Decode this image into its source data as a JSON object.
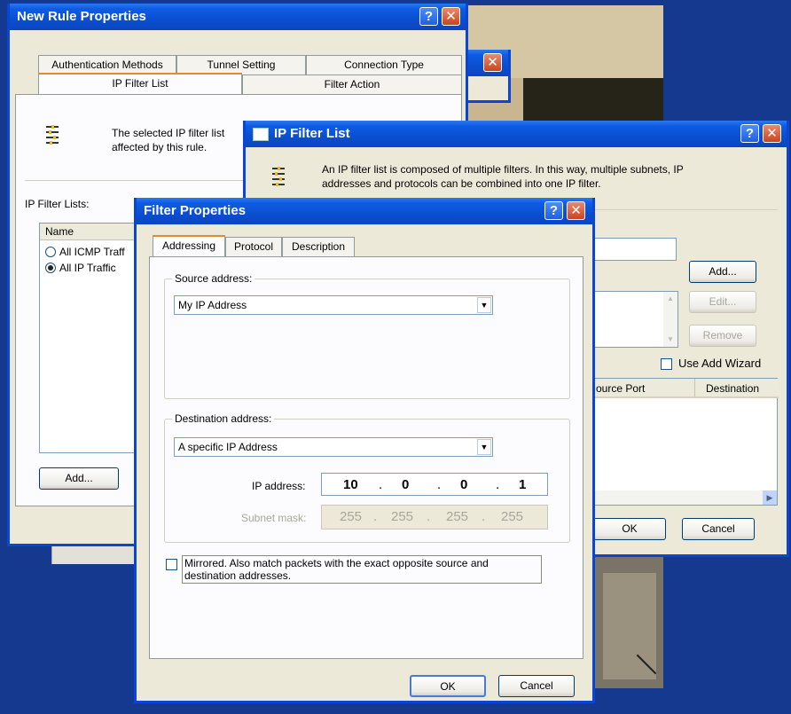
{
  "rule": {
    "title": "New Rule Properties",
    "tabs": [
      "Authentication Methods",
      "Tunnel Setting",
      "Connection Type",
      "IP Filter List",
      "Filter Action"
    ],
    "description": "The selected IP filter list specifies which network traffic will be affected by this rule.",
    "description_line1": "The selected IP filter list",
    "description_line2": "affected by this rule.",
    "lists_label": "IP Filter Lists:",
    "column_name": "Name",
    "items": [
      {
        "label": "All ICMP Traffic",
        "visible": "All ICMP Traff",
        "selected": false
      },
      {
        "label": "All IP Traffic",
        "visible": "All IP Traffic",
        "selected": true
      }
    ],
    "add_label": "Add..."
  },
  "filter_list": {
    "title": "IP Filter List",
    "description_line1": "An IP filter list is composed of multiple filters. In this way, multiple subnets, IP",
    "description_line2": "addresses and protocols can be combined into one IP filter.",
    "add_label": "Add...",
    "edit_label": "Edit...",
    "remove_label": "Remove",
    "wizard_label": "Use Add Wizard",
    "col_source_port": "ource Port",
    "col_destination": "Destination",
    "ok_label": "OK",
    "cancel_label": "Cancel"
  },
  "filter": {
    "title": "Filter Properties",
    "tabs": [
      "Addressing",
      "Protocol",
      "Description"
    ],
    "source_label": "Source address:",
    "source_value": "My IP Address",
    "dest_label": "Destination address:",
    "dest_value": "A specific IP Address",
    "ip_label": "IP address:",
    "ip_octets": [
      "10",
      "0",
      "0",
      "1"
    ],
    "subnet_label": "Subnet mask:",
    "subnet_octets": [
      "255",
      "255",
      "255",
      "255"
    ],
    "mirror_line1": "Mirrored. Also match packets with the exact opposite source and",
    "mirror_line2": "destination addresses.",
    "ok_label": "OK",
    "cancel_label": "Cancel"
  },
  "colors": {
    "desktop": "#15398e",
    "titlebar": "#0a4fd1",
    "face": "#ece9d8",
    "close": "#c94520"
  }
}
